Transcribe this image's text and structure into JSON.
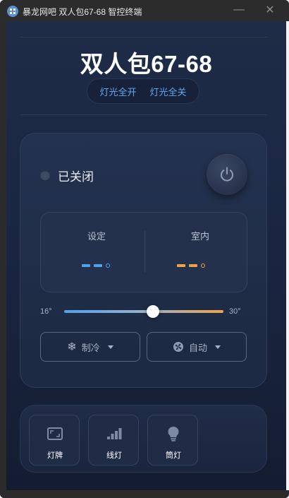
{
  "window": {
    "title": "暴龙网吧 双人包67-68 智控终端",
    "minimize_glyph": "—",
    "close_glyph": "✕"
  },
  "header": {
    "room_name": "双人包67-68",
    "lights_on_label": "灯光全开",
    "lights_off_label": "灯光全关"
  },
  "ac": {
    "status_text": "已关闭",
    "power_on": false,
    "set_label": "设定",
    "room_label": "室内",
    "set_color": "#4da3f0",
    "room_color": "#f0a24a",
    "slider_min_label": "16°",
    "slider_max_label": "30°",
    "slider_value_fraction": 0.56,
    "mode_label": "制冷",
    "fan_label": "自动"
  },
  "devices": [
    {
      "label": "灯牌",
      "icon": "sign-icon"
    },
    {
      "label": "线灯",
      "icon": "bars-icon"
    },
    {
      "label": "筒灯",
      "icon": "bulb-icon"
    }
  ]
}
